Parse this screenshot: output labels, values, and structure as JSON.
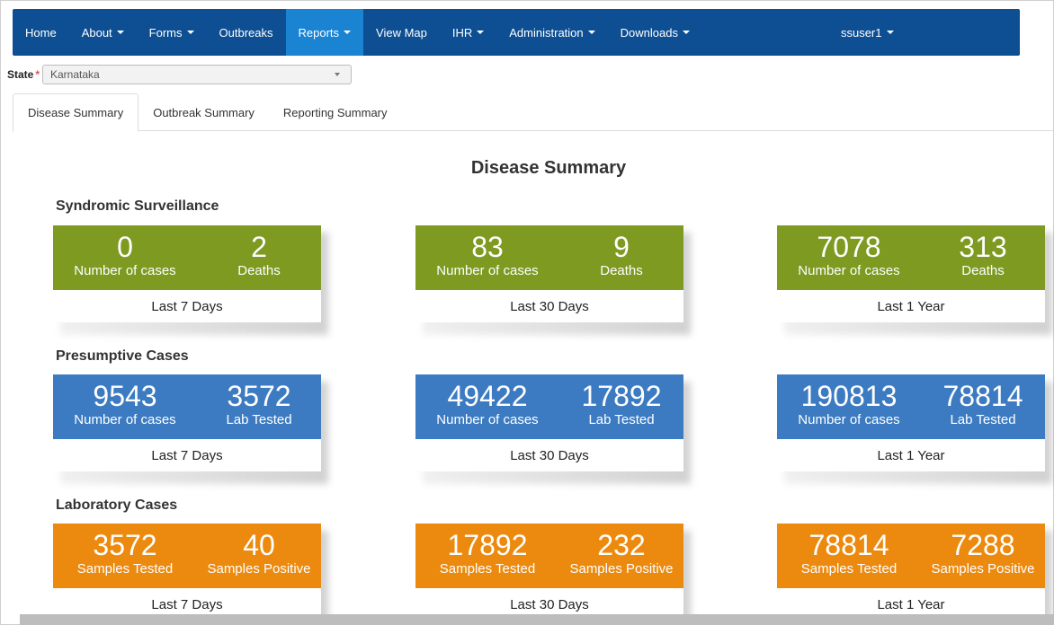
{
  "nav": {
    "items": [
      {
        "label": "Home",
        "dropdown": false
      },
      {
        "label": "About",
        "dropdown": true
      },
      {
        "label": "Forms",
        "dropdown": true
      },
      {
        "label": "Outbreaks",
        "dropdown": false
      },
      {
        "label": "Reports",
        "dropdown": true,
        "active": true
      },
      {
        "label": "View Map",
        "dropdown": false
      },
      {
        "label": "IHR",
        "dropdown": true
      },
      {
        "label": "Administration",
        "dropdown": true
      },
      {
        "label": "Downloads",
        "dropdown": true
      }
    ],
    "user": "ssuser1"
  },
  "state": {
    "label": "State",
    "required_mark": "*",
    "value": "Karnataka"
  },
  "tabs": [
    "Disease Summary",
    "Outbreak Summary",
    "Reporting Summary"
  ],
  "page_title": "Disease Summary",
  "sections": [
    {
      "title": "Syndromic Surveillance",
      "color": "#7e9a21",
      "cards": [
        {
          "left_value": "0",
          "left_label": "Number of cases",
          "right_value": "2",
          "right_label": "Deaths",
          "period": "Last 7 Days"
        },
        {
          "left_value": "83",
          "left_label": "Number of cases",
          "right_value": "9",
          "right_label": "Deaths",
          "period": "Last 30 Days"
        },
        {
          "left_value": "7078",
          "left_label": "Number of cases",
          "right_value": "313",
          "right_label": "Deaths",
          "period": "Last 1 Year"
        }
      ]
    },
    {
      "title": "Presumptive Cases",
      "color": "#3c7bc1",
      "cards": [
        {
          "left_value": "9543",
          "left_label": "Number of cases",
          "right_value": "3572",
          "right_label": "Lab Tested",
          "period": "Last 7 Days"
        },
        {
          "left_value": "49422",
          "left_label": "Number of cases",
          "right_value": "17892",
          "right_label": "Lab Tested",
          "period": "Last 30 Days"
        },
        {
          "left_value": "190813",
          "left_label": "Number of cases",
          "right_value": "78814",
          "right_label": "Lab Tested",
          "period": "Last 1 Year"
        }
      ]
    },
    {
      "title": "Laboratory Cases",
      "color": "#ec8a0f",
      "cards": [
        {
          "left_value": "3572",
          "left_label": "Samples Tested",
          "right_value": "40",
          "right_label": "Samples Positive",
          "period": "Last 7 Days"
        },
        {
          "left_value": "17892",
          "left_label": "Samples Tested",
          "right_value": "232",
          "right_label": "Samples Positive",
          "period": "Last 30 Days"
        },
        {
          "left_value": "78814",
          "left_label": "Samples Tested",
          "right_value": "7288",
          "right_label": "Samples Positive",
          "period": "Last 1 Year"
        }
      ]
    }
  ]
}
